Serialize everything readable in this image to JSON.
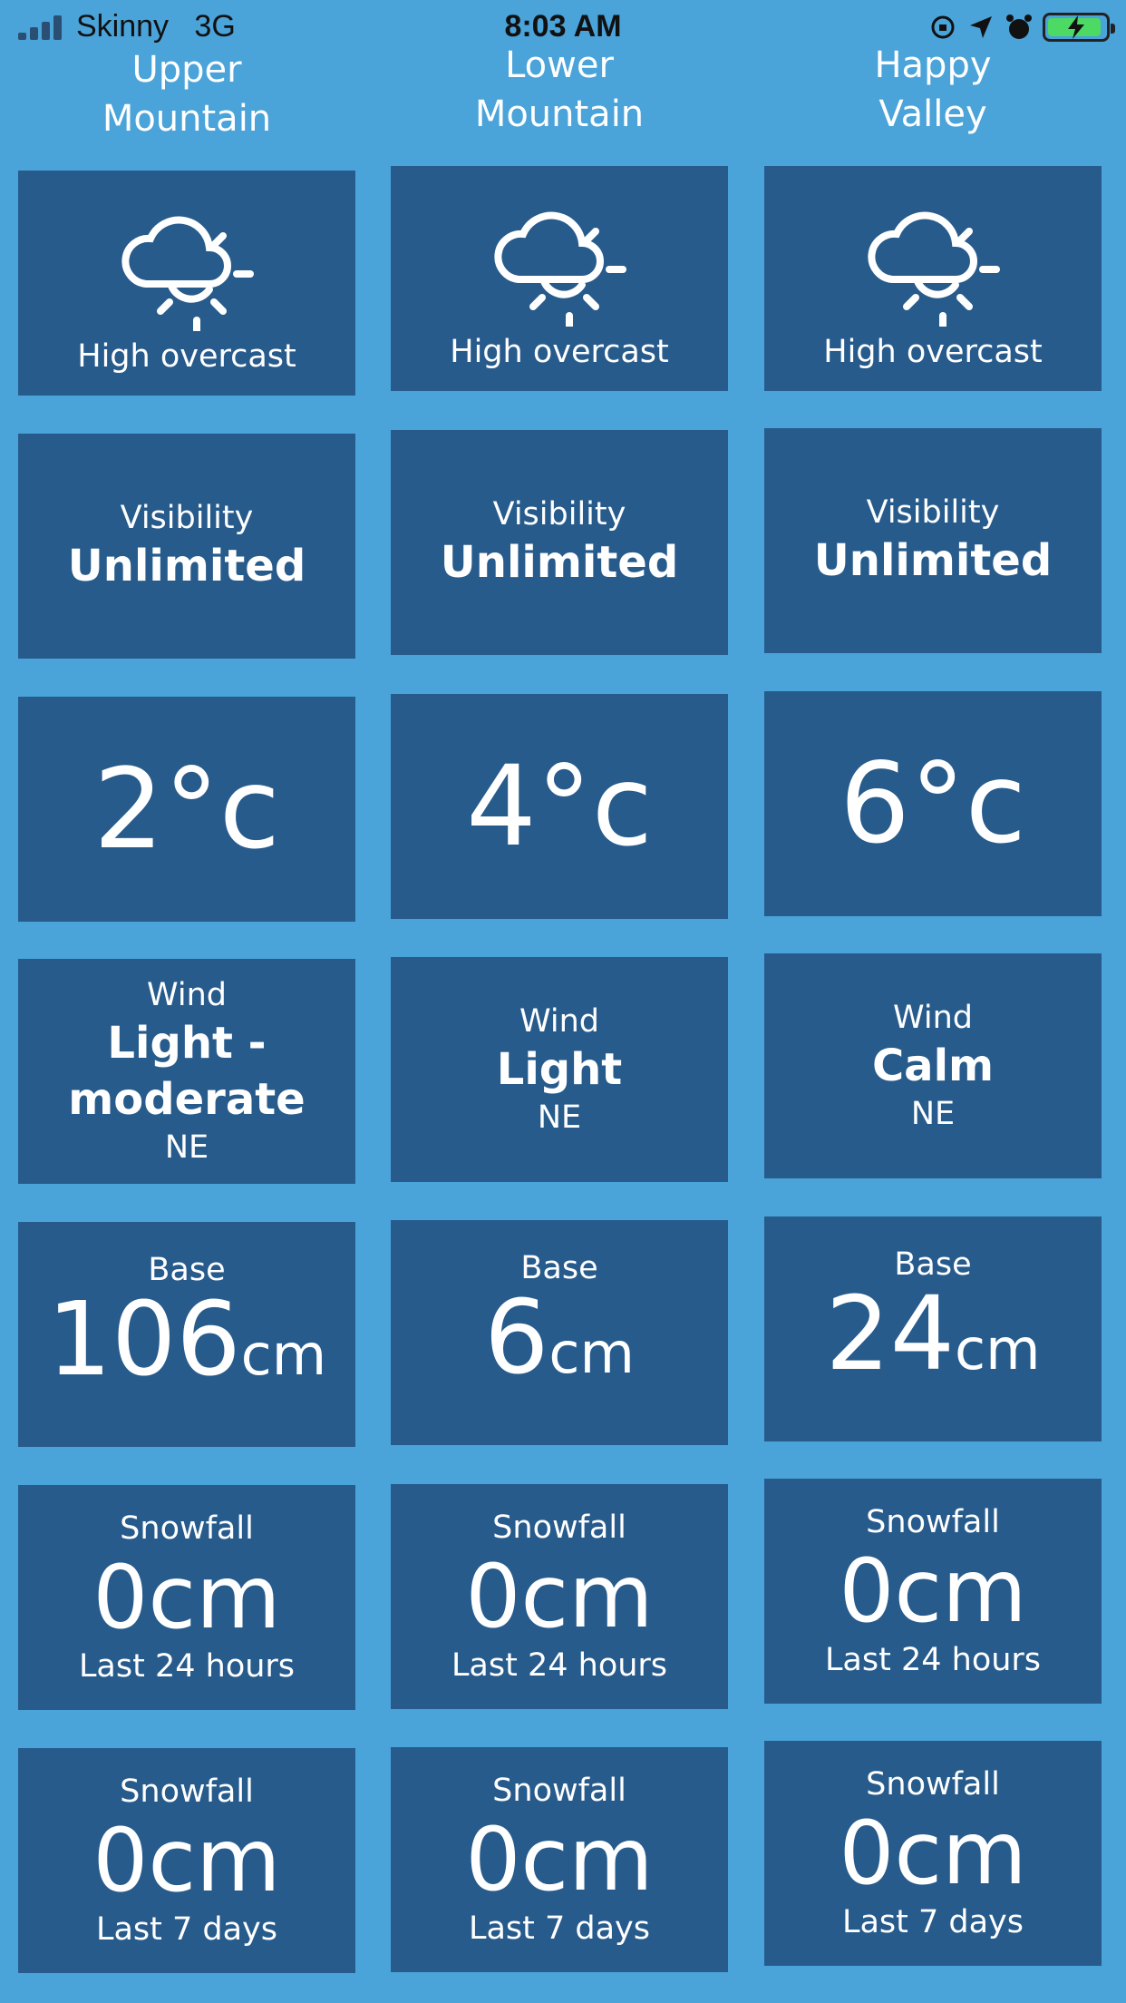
{
  "status_bar": {
    "carrier": "Skinny",
    "network": "3G",
    "time": "8:03 AM"
  },
  "columns": [
    {
      "name_line1": "Upper",
      "name_line2": "Mountain",
      "condition": "High overcast",
      "visibility_label": "Visibility",
      "visibility": "Unlimited",
      "temperature": "2°c",
      "wind_label": "Wind",
      "wind_line1": "Light -",
      "wind_line2": "moderate",
      "wind_dir": "NE",
      "base_label": "Base",
      "base_value": "106",
      "base_unit": "cm",
      "snow24_label": "Snowfall",
      "snow24_value": "0cm",
      "snow24_period": "Last 24 hours",
      "snow7_label": "Snowfall",
      "snow7_value": "0cm",
      "snow7_period": "Last 7 days"
    },
    {
      "name_line1": "Lower",
      "name_line2": "Mountain",
      "condition": "High overcast",
      "visibility_label": "Visibility",
      "visibility": "Unlimited",
      "temperature": "4°c",
      "wind_label": "Wind",
      "wind_line1": "Light",
      "wind_dir": "NE",
      "base_label": "Base",
      "base_value": "6",
      "base_unit": "cm",
      "snow24_label": "Snowfall",
      "snow24_value": "0cm",
      "snow24_period": "Last 24 hours",
      "snow7_label": "Snowfall",
      "snow7_value": "0cm",
      "snow7_period": "Last 7 days"
    },
    {
      "name_line1": "Happy",
      "name_line2": "Valley",
      "condition": "High overcast",
      "visibility_label": "Visibility",
      "visibility": "Unlimited",
      "temperature": "6°c",
      "wind_label": "Wind",
      "wind_line1": "Calm",
      "wind_dir": "NE",
      "base_label": "Base",
      "base_value": "24",
      "base_unit": "cm",
      "snow24_label": "Snowfall",
      "snow24_value": "0cm",
      "snow24_period": "Last 24 hours",
      "snow7_label": "Snowfall",
      "snow7_value": "0cm",
      "snow7_period": "Last 7 days"
    }
  ],
  "icons": {
    "condition": "cloud-sun-icon",
    "alarm": "alarm-icon",
    "location": "location-arrow-icon",
    "rotation_lock": "rotation-lock-icon",
    "battery": "battery-charging-icon"
  },
  "colors": {
    "background": "#4aa3d9",
    "tile": "#275b8c",
    "battery": "#4cd964"
  }
}
